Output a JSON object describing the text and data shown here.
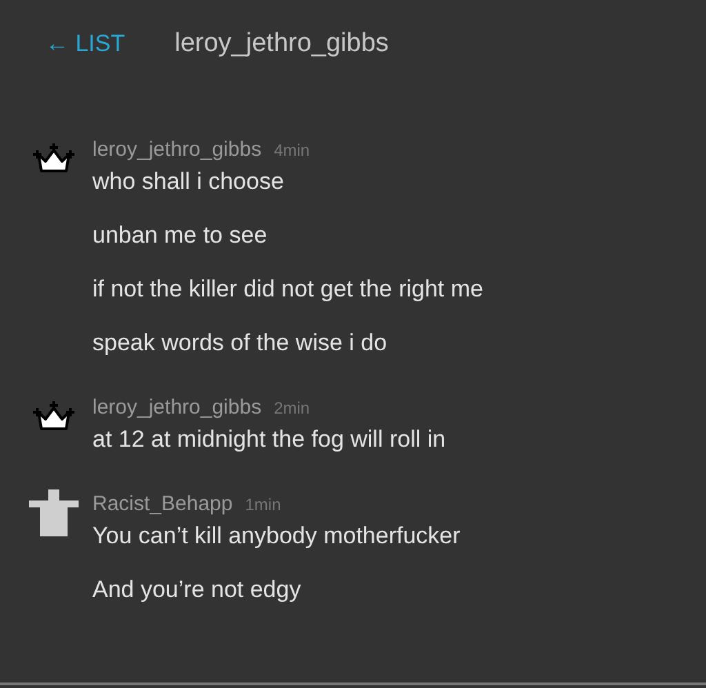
{
  "header": {
    "back_link": "← LIST",
    "title": "leroy_jethro_gibbs"
  },
  "messages": [
    {
      "avatar": {
        "kind": "crown"
      },
      "username": "leroy_jethro_gibbs",
      "time": "4min",
      "lines": [
        "who shall i choose",
        "unban me to see",
        "if not the killer did not get the right me",
        "speak words of the wise i do"
      ]
    },
    {
      "avatar": {
        "kind": "crown"
      },
      "username": "leroy_jethro_gibbs",
      "time": "2min",
      "lines": [
        "at 12 at midnight the fog will roll in"
      ]
    },
    {
      "avatar": {
        "kind": "default"
      },
      "username": "Racist_Behapp",
      "time": "1min",
      "lines": [
        "You can’t kill anybody motherfucker",
        "And you’re not edgy"
      ]
    }
  ]
}
